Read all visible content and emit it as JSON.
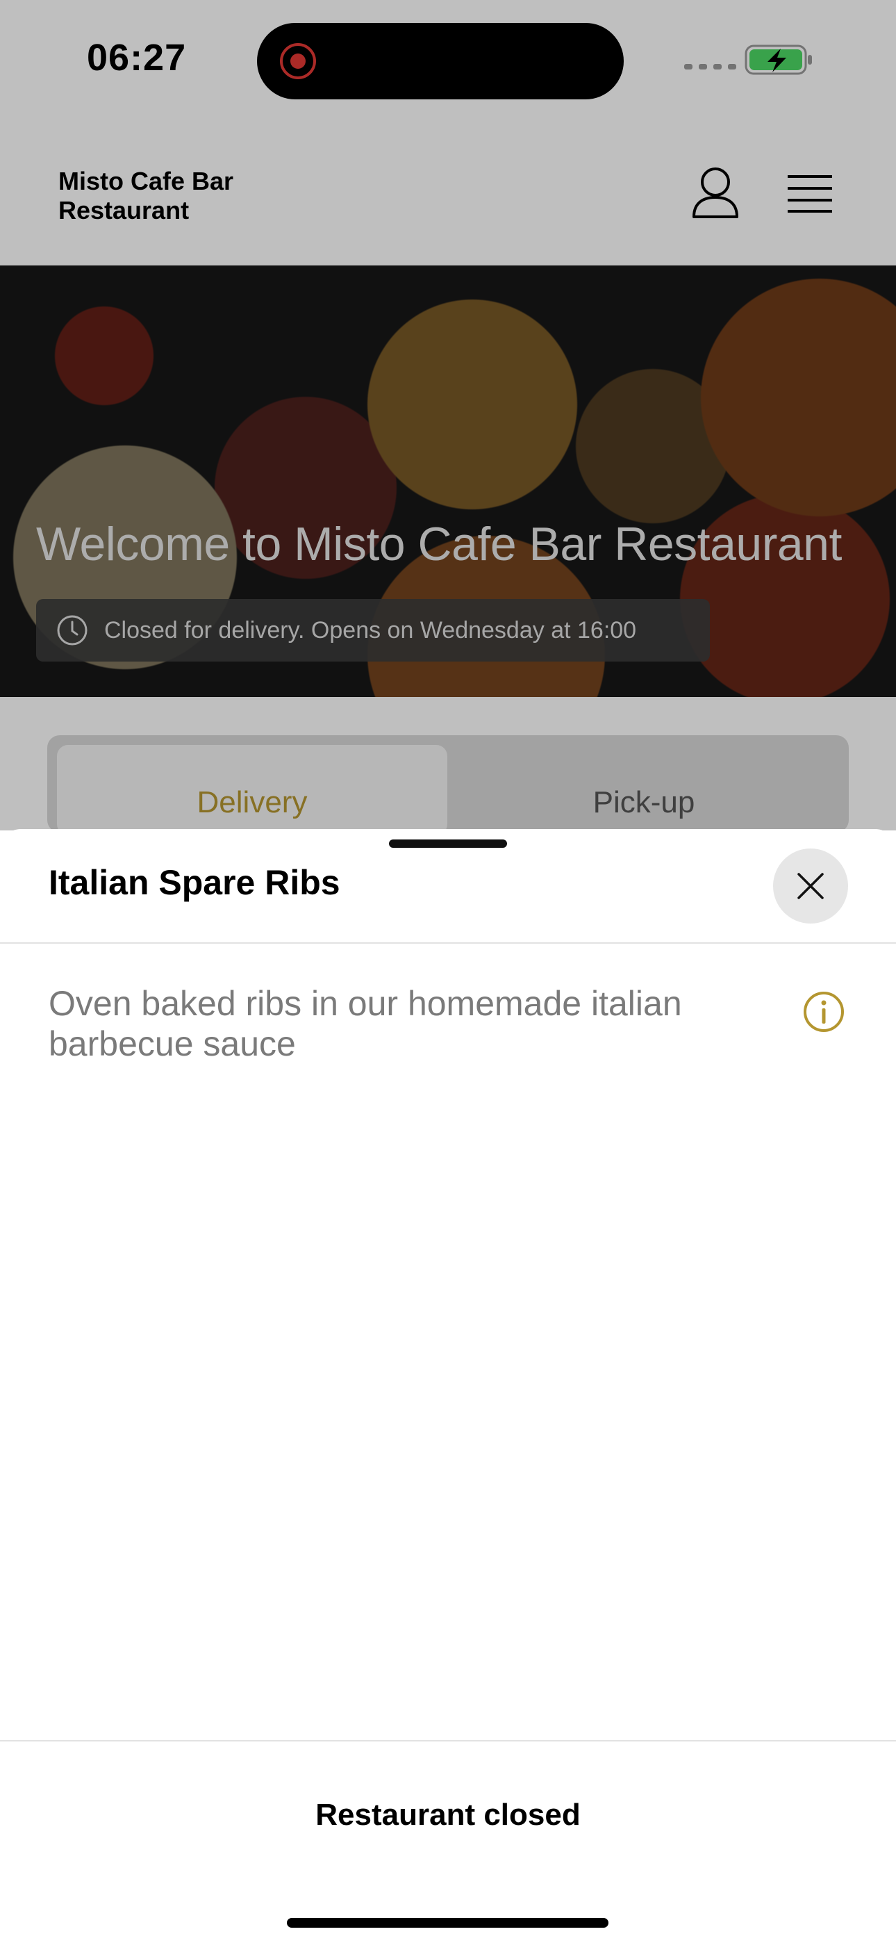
{
  "status_bar": {
    "time": "06:27"
  },
  "header": {
    "brand_line1": "Misto Cafe Bar",
    "brand_line2": "Restaurant"
  },
  "hero": {
    "title": "Welcome to Misto Cafe Bar Restaurant",
    "status": "Closed for delivery. Opens on Wednesday at 16:00"
  },
  "tabs": [
    {
      "label": "Delivery",
      "selected": true
    },
    {
      "label": "Pick-up",
      "selected": false
    }
  ],
  "sheet": {
    "title": "Italian Spare Ribs",
    "description": "Oven baked ribs in our homemade italian barbecue sauce",
    "footer_label": "Restaurant closed"
  },
  "colors": {
    "accent": "#b49630",
    "record": "#e53935",
    "battery": "#4cd964"
  },
  "icons": [
    "record-icon",
    "signal-icon",
    "battery-charging-icon",
    "user-icon",
    "menu-icon",
    "clock-icon",
    "close-icon",
    "info-icon"
  ]
}
